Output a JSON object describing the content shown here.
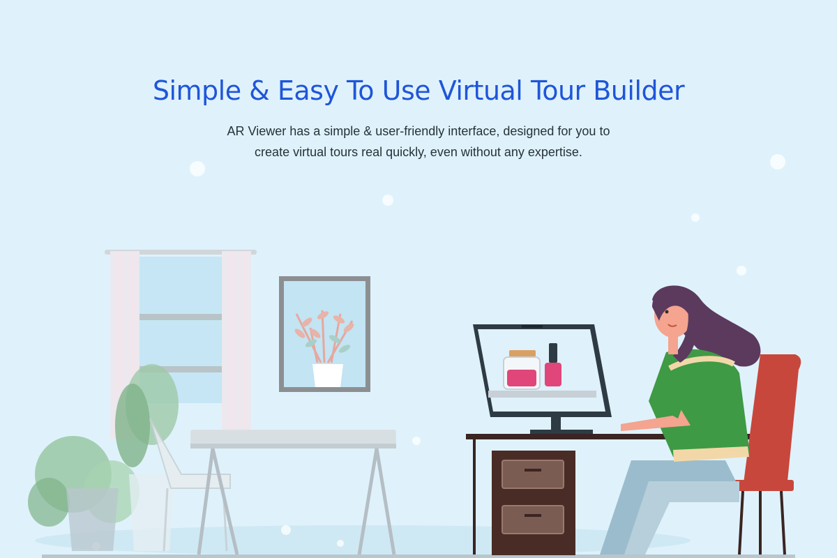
{
  "hero": {
    "title": "Simple & Easy To Use Virtual Tour Builder",
    "description_line_1": "AR Viewer has a simple & user-friendly interface, designed for you to",
    "description_line_2": "create virtual tours real quickly, even without any expertise."
  },
  "colors": {
    "background": "#dff2fb",
    "title": "#1f55d9",
    "body_text": "#263238"
  }
}
